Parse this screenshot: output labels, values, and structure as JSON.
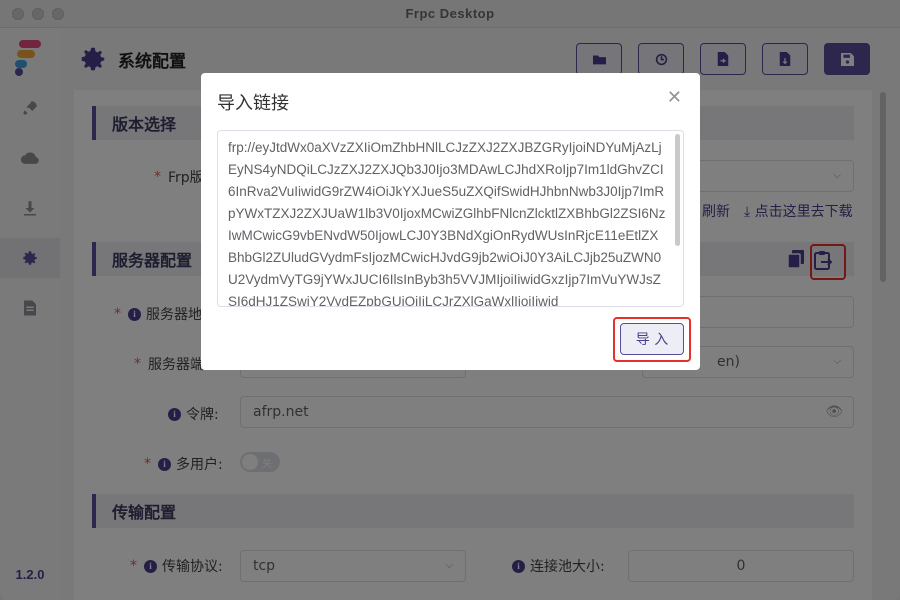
{
  "window": {
    "title": "Frpc Desktop"
  },
  "sidebar": {
    "items": [
      {
        "icon": "rocket-icon"
      },
      {
        "icon": "cloud-icon"
      },
      {
        "icon": "download-icon"
      },
      {
        "icon": "gear-icon",
        "active": true
      },
      {
        "icon": "document-icon"
      }
    ],
    "version": "1.2.0"
  },
  "header": {
    "title": "系统配置",
    "toolbar": [
      "folder-icon",
      "history-icon",
      "file-export-icon",
      "file-import-icon",
      "save-icon"
    ]
  },
  "sections": {
    "version": {
      "title": "版本选择"
    },
    "server": {
      "title": "服务器配置"
    },
    "transport": {
      "title": "传输配置"
    }
  },
  "form": {
    "frp_version": {
      "label": "Frp版"
    },
    "links": {
      "refresh": "刷新",
      "download": "点击这里去下载"
    },
    "server_addr": {
      "label": "服务器地"
    },
    "server_port": {
      "label": "服务器端"
    },
    "auth_method_suffix": "en)",
    "token": {
      "label": "令牌:",
      "value": "afrp.net"
    },
    "multi_user": {
      "label": "多用户:",
      "toggle_text": "关"
    },
    "protocol": {
      "label": "传输协议:",
      "value": "tcp"
    },
    "pool": {
      "label": "连接池大小:",
      "value": "0"
    }
  },
  "dialog": {
    "title": "导入链接",
    "content": "frp://eyJtdWx0aXVzZXIiOmZhbHNlLCJzZXJ2ZXJBZGRyIjoiNDYuMjAzLjEyNS4yNDQiLCJzZXJ2ZXJQb3J0Ijo3MDAwLCJhdXRoIjp7Im1ldGhvZCI6InRva2VuIiwidG9rZW4iOiJkYXJueS5uZXQifSwidHJhbnNwb3J0Ijp7ImRpYWxTZXJ2ZXJUaW1lb3V0IjoxMCwiZGlhbFNlcnZlcktlZXBhbGl2ZSI6NzIwMCwicG9vbENvdW50IjowLCJ0Y3BNdXgiOnRydWUsInRjcE11eEtlZXBhbGl2ZUludGVydmFsIjozMCwicHJvdG9jb2wiOiJ0Y3AiLCJjb25uZWN0U2VydmVyTG9jYWxJUCI6IlsInByb3h5VVJMIjoiIiwidGxzIjp7ImVuYWJsZSI6dHJ1ZSwiY2VydEZpbGUiOiIiLCJrZXlGaWxlIjoiIiwid",
    "confirm_label": "导 入",
    "close_icon": "close-icon"
  }
}
